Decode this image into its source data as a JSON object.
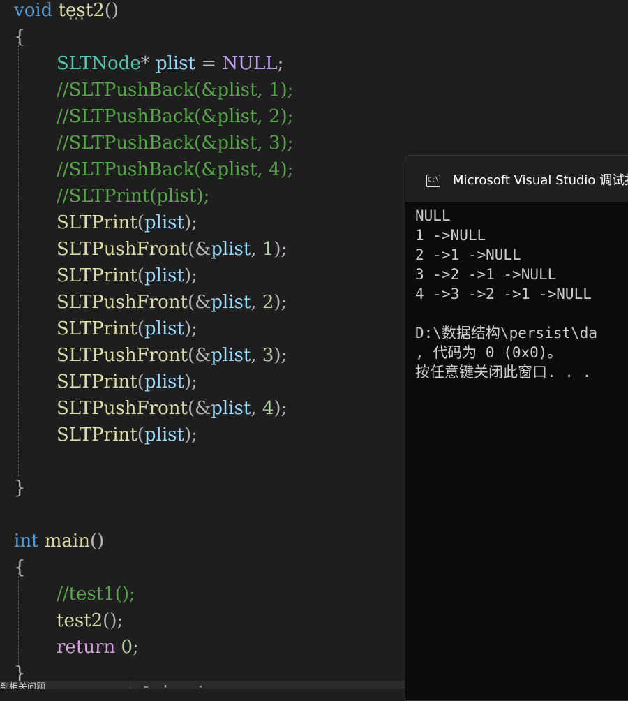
{
  "editor": {
    "lines": [
      {
        "tokens": [
          [
            "void",
            "kw"
          ],
          [
            " ",
            ""
          ],
          [
            "test2",
            "fn"
          ],
          [
            "()",
            "pun"
          ]
        ]
      },
      {
        "tokens": [
          [
            "{",
            "pun"
          ]
        ]
      },
      {
        "tokens": [
          [
            "SLTNode",
            "ty"
          ],
          [
            "* ",
            "pun"
          ],
          [
            "plist",
            "var"
          ],
          [
            " = ",
            "pun"
          ],
          [
            "NULL",
            "mac"
          ],
          [
            ";",
            "pun"
          ]
        ]
      },
      {
        "tokens": [
          [
            "//SLTPushBack(&plist, 1);",
            "cm"
          ]
        ]
      },
      {
        "tokens": [
          [
            "//SLTPushBack(&plist, 2);",
            "cm"
          ]
        ]
      },
      {
        "tokens": [
          [
            "//SLTPushBack(&plist, 3);",
            "cm"
          ]
        ]
      },
      {
        "tokens": [
          [
            "//SLTPushBack(&plist, 4);",
            "cm"
          ]
        ]
      },
      {
        "tokens": [
          [
            "//SLTPrint(plist);",
            "cm"
          ]
        ]
      },
      {
        "tokens": [
          [
            "SLTPrint",
            "fn"
          ],
          [
            "(",
            "pun"
          ],
          [
            "plist",
            "var"
          ],
          [
            ");",
            "pun"
          ]
        ]
      },
      {
        "tokens": [
          [
            "SLTPushFront",
            "fn"
          ],
          [
            "(&",
            "pun"
          ],
          [
            "plist",
            "var"
          ],
          [
            ", ",
            "pun"
          ],
          [
            "1",
            "num"
          ],
          [
            ");",
            "pun"
          ]
        ]
      },
      {
        "tokens": [
          [
            "SLTPrint",
            "fn"
          ],
          [
            "(",
            "pun"
          ],
          [
            "plist",
            "var"
          ],
          [
            ");",
            "pun"
          ]
        ]
      },
      {
        "tokens": [
          [
            "SLTPushFront",
            "fn"
          ],
          [
            "(&",
            "pun"
          ],
          [
            "plist",
            "var"
          ],
          [
            ", ",
            "pun"
          ],
          [
            "2",
            "num"
          ],
          [
            ");",
            "pun"
          ]
        ]
      },
      {
        "tokens": [
          [
            "SLTPrint",
            "fn"
          ],
          [
            "(",
            "pun"
          ],
          [
            "plist",
            "var"
          ],
          [
            ");",
            "pun"
          ]
        ]
      },
      {
        "tokens": [
          [
            "SLTPushFront",
            "fn"
          ],
          [
            "(&",
            "pun"
          ],
          [
            "plist",
            "var"
          ],
          [
            ", ",
            "pun"
          ],
          [
            "3",
            "num"
          ],
          [
            ");",
            "pun"
          ]
        ]
      },
      {
        "tokens": [
          [
            "SLTPrint",
            "fn"
          ],
          [
            "(",
            "pun"
          ],
          [
            "plist",
            "var"
          ],
          [
            ");",
            "pun"
          ]
        ]
      },
      {
        "tokens": [
          [
            "SLTPushFront",
            "fn"
          ],
          [
            "(&",
            "pun"
          ],
          [
            "plist",
            "var"
          ],
          [
            ", ",
            "pun"
          ],
          [
            "4",
            "num"
          ],
          [
            ");",
            "pun"
          ]
        ]
      },
      {
        "tokens": [
          [
            "SLTPrint",
            "fn"
          ],
          [
            "(",
            "pun"
          ],
          [
            "plist",
            "var"
          ],
          [
            ");",
            "pun"
          ]
        ]
      },
      {
        "tokens": []
      },
      {
        "tokens": [
          [
            "}",
            "pun"
          ]
        ]
      },
      {
        "tokens": []
      },
      {
        "tokens": [
          [
            "int",
            "kw"
          ],
          [
            " ",
            ""
          ],
          [
            "main",
            "fn"
          ],
          [
            "()",
            "pun"
          ]
        ]
      },
      {
        "tokens": [
          [
            "{",
            "pun"
          ]
        ]
      },
      {
        "tokens": [
          [
            "//test1();",
            "cm"
          ]
        ]
      },
      {
        "tokens": [
          [
            "test2",
            "fn"
          ],
          [
            "();",
            "pun"
          ]
        ]
      },
      {
        "tokens": [
          [
            "return",
            "kw2"
          ],
          [
            " ",
            ""
          ],
          [
            "0",
            "num"
          ],
          [
            ";",
            "pun"
          ]
        ]
      },
      {
        "tokens": [
          [
            "}",
            "pun"
          ]
        ]
      }
    ]
  },
  "console": {
    "icon_label": "C:\\",
    "title": "Microsoft Visual Studio 调试控",
    "lines": [
      "NULL",
      "1 ->NULL",
      "2 ->1 ->NULL",
      "3 ->2 ->1 ->NULL",
      "4 ->3 ->2 ->1 ->NULL",
      "",
      "D:\\数据结构\\persist\\da",
      ", 代码为 0 (0x0)。",
      "按任意键关闭此窗口. . ."
    ]
  },
  "statusbar": {
    "text": "到相关问题",
    "icon": "✂",
    "caret": "▾",
    "arrow": "◂"
  }
}
